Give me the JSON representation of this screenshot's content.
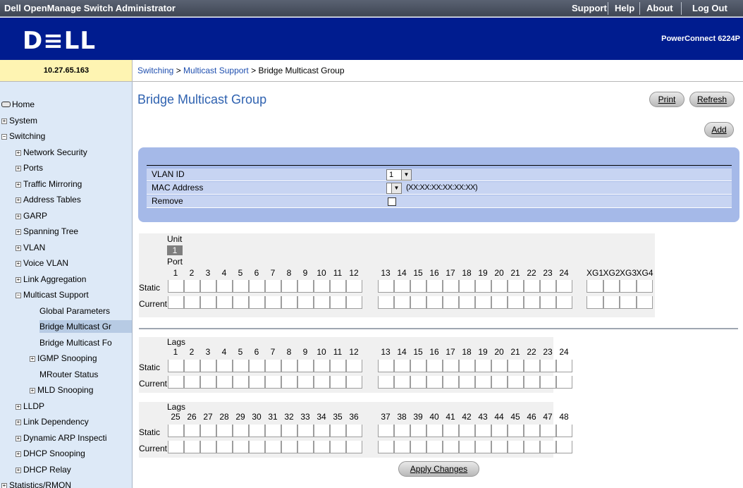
{
  "header": {
    "app_title": "Dell OpenManage Switch Administrator",
    "links": [
      "Support",
      "Help",
      "About",
      "Log Out"
    ],
    "logo_text": "D≡LL",
    "model": "PowerConnect 6224P"
  },
  "ip": "10.27.65.163",
  "breadcrumb": {
    "part1": "Switching",
    "sep1": " > ",
    "part2": "Multicast Support",
    "sep2": " > ",
    "part3": "Bridge Multicast Group"
  },
  "sidebar": {
    "items": [
      {
        "label": "Home",
        "icon": "home-icon",
        "indent": 0
      },
      {
        "label": "System",
        "icon": "expand-plus-icon",
        "indent": 0
      },
      {
        "label": "Switching",
        "icon": "collapse-minus-icon",
        "indent": 0
      },
      {
        "label": "Network Security",
        "icon": "expand-plus-icon",
        "indent": 1
      },
      {
        "label": "Ports",
        "icon": "expand-plus-icon",
        "indent": 1
      },
      {
        "label": "Traffic Mirroring",
        "icon": "expand-plus-icon",
        "indent": 1
      },
      {
        "label": "Address Tables",
        "icon": "expand-plus-icon",
        "indent": 1
      },
      {
        "label": "GARP",
        "icon": "expand-plus-icon",
        "indent": 1
      },
      {
        "label": "Spanning Tree",
        "icon": "expand-plus-icon",
        "indent": 1
      },
      {
        "label": "VLAN",
        "icon": "expand-plus-icon",
        "indent": 1
      },
      {
        "label": "Voice VLAN",
        "icon": "expand-plus-icon",
        "indent": 1
      },
      {
        "label": "Link Aggregation",
        "icon": "expand-plus-icon",
        "indent": 1
      },
      {
        "label": "Multicast Support",
        "icon": "collapse-minus-icon",
        "indent": 1
      },
      {
        "label": "Global Parameters",
        "icon": "",
        "indent": 2
      },
      {
        "label": "Bridge Multicast Gr",
        "icon": "",
        "indent": 2,
        "selected": true
      },
      {
        "label": "Bridge Multicast Fo",
        "icon": "",
        "indent": 2
      },
      {
        "label": "IGMP Snooping",
        "icon": "expand-plus-icon",
        "indent": 2
      },
      {
        "label": "MRouter Status",
        "icon": "",
        "indent": 2
      },
      {
        "label": "MLD Snooping",
        "icon": "expand-plus-icon",
        "indent": 2
      },
      {
        "label": "LLDP",
        "icon": "expand-plus-icon",
        "indent": 1
      },
      {
        "label": "Link Dependency",
        "icon": "expand-plus-icon",
        "indent": 1
      },
      {
        "label": "Dynamic ARP Inspecti",
        "icon": "expand-plus-icon",
        "indent": 1
      },
      {
        "label": "DHCP Snooping",
        "icon": "expand-plus-icon",
        "indent": 1
      },
      {
        "label": "DHCP Relay",
        "icon": "expand-plus-icon",
        "indent": 1
      },
      {
        "label": "Statistics/RMON",
        "icon": "expand-plus-icon",
        "indent": 0
      }
    ]
  },
  "main": {
    "title": "Bridge Multicast Group",
    "print_label": "Print",
    "refresh_label": "Refresh",
    "add_label": "Add",
    "form": {
      "vlan_label": "VLAN ID",
      "vlan_value": "1",
      "mac_label": "MAC Address",
      "mac_value": "",
      "mac_hint": "(XX:XX:XX:XX:XX:XX)",
      "remove_label": "Remove"
    },
    "unit_label": "Unit",
    "unit_value": "1",
    "port_label": "Port",
    "static_label": "Static",
    "current_label": "Current",
    "ports_a": [
      "1",
      "2",
      "3",
      "4",
      "5",
      "6",
      "7",
      "8",
      "9",
      "10",
      "11",
      "12"
    ],
    "ports_b": [
      "13",
      "14",
      "15",
      "16",
      "17",
      "18",
      "19",
      "20",
      "21",
      "22",
      "23",
      "24"
    ],
    "ports_xg": [
      "XG1",
      "XG2",
      "XG3",
      "XG4"
    ],
    "lags_label": "Lags",
    "lags1_a": [
      "1",
      "2",
      "3",
      "4",
      "5",
      "6",
      "7",
      "8",
      "9",
      "10",
      "11",
      "12"
    ],
    "lags1_b": [
      "13",
      "14",
      "15",
      "16",
      "17",
      "18",
      "19",
      "20",
      "21",
      "22",
      "23",
      "24"
    ],
    "lags2_a": [
      "25",
      "26",
      "27",
      "28",
      "29",
      "30",
      "31",
      "32",
      "33",
      "34",
      "35",
      "36"
    ],
    "lags2_b": [
      "37",
      "38",
      "39",
      "40",
      "41",
      "42",
      "43",
      "44",
      "45",
      "46",
      "47",
      "48"
    ],
    "apply_label": "Apply Changes"
  }
}
